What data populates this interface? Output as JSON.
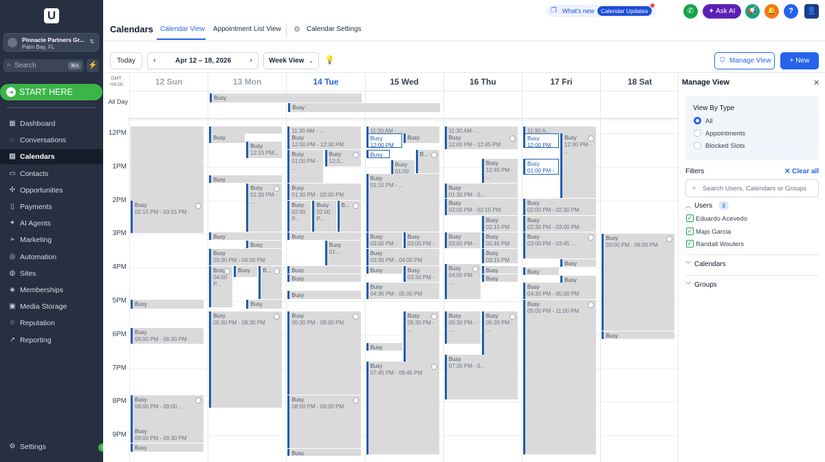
{
  "sidebar": {
    "logo": "U",
    "account": {
      "name": "Pinnacle Partners Gr...",
      "location": "Palm Bay, FL"
    },
    "search": {
      "placeholder": "Search",
      "shortcut": "⌘K"
    },
    "start_here": "START HERE",
    "nav": [
      {
        "label": "Dashboard",
        "icon": "dashboard-icon",
        "glyph": "▦"
      },
      {
        "label": "Conversations",
        "icon": "chat-icon",
        "glyph": "◌"
      },
      {
        "label": "Calendars",
        "icon": "calendar-icon",
        "glyph": "▤",
        "active": true
      },
      {
        "label": "Contacts",
        "icon": "contacts-icon",
        "glyph": "▭"
      },
      {
        "label": "Opportunities",
        "icon": "opportunities-icon",
        "glyph": "✣"
      },
      {
        "label": "Payments",
        "icon": "payments-icon",
        "glyph": "▯"
      },
      {
        "label": "AI Agents",
        "icon": "sparkle-icon",
        "glyph": "✦"
      },
      {
        "label": "Marketing",
        "icon": "send-icon",
        "glyph": "➢"
      },
      {
        "label": "Automation",
        "icon": "automation-icon",
        "glyph": "◎"
      },
      {
        "label": "Sites",
        "icon": "globe-icon",
        "glyph": "◍"
      },
      {
        "label": "Memberships",
        "icon": "memberships-icon",
        "glyph": "◈"
      },
      {
        "label": "Media Storage",
        "icon": "image-icon",
        "glyph": "▣"
      },
      {
        "label": "Reputation",
        "icon": "star-icon",
        "glyph": "☆"
      },
      {
        "label": "Reporting",
        "icon": "chart-icon",
        "glyph": "↗"
      }
    ],
    "settings": "Settings"
  },
  "header": {
    "title": "Calendars",
    "tabs": [
      "Calendar View",
      "Appointment List View",
      "Calendar Settings"
    ],
    "whats_new": "What's new",
    "updates_pill": "Calendar Updates",
    "ask_ai": "Ask AI",
    "help": "?"
  },
  "toolbar": {
    "today": "Today",
    "date_range": "Apr 12 – 18, 2026",
    "view": "Week View",
    "manage_view": "Manage View",
    "new": "New"
  },
  "calendar": {
    "gmt": "GMT\n-04:00",
    "all_day": "All Day",
    "days": [
      {
        "label": "12 Sun",
        "state": "past"
      },
      {
        "label": "13 Mon",
        "state": "past"
      },
      {
        "label": "14 Tue",
        "state": "today"
      },
      {
        "label": "15 Wed",
        "state": ""
      },
      {
        "label": "16 Thu",
        "state": ""
      },
      {
        "label": "17 Fri",
        "state": ""
      },
      {
        "label": "18 Sat",
        "state": ""
      }
    ],
    "hours": [
      "12PM",
      "1PM",
      "2PM",
      "3PM",
      "4PM",
      "5PM",
      "6PM",
      "7PM",
      "8PM",
      "9PM"
    ],
    "all_day_events": [
      {
        "day": 1,
        "span": 2,
        "row": 0,
        "title": "Busy"
      },
      {
        "day": 2,
        "span": 2,
        "row": 1,
        "title": "Busy"
      }
    ],
    "events": [
      {
        "day": 0,
        "start": 11.8,
        "end": 14.2,
        "col": 0,
        "cols": 1,
        "title": "",
        "time": "",
        "nb": true
      },
      {
        "day": 0,
        "start": 14.0,
        "end": 15.0,
        "col": 0,
        "cols": 1,
        "title": "Busy",
        "time": "02:15 PM - 03:15 PM",
        "icons": true
      },
      {
        "day": 0,
        "start": 16.95,
        "end": 17.25,
        "col": 0,
        "cols": 1,
        "title": "Busy",
        "time": ""
      },
      {
        "day": 0,
        "start": 17.8,
        "end": 18.3,
        "col": 0,
        "cols": 1,
        "title": "Busy",
        "time": "06:00 PM - 06:30 PM"
      },
      {
        "day": 0,
        "start": 19.8,
        "end": 20.8,
        "col": 0,
        "cols": 1,
        "title": "Busy",
        "time": "08:00 PM - 09:00 ...",
        "icons": true
      },
      {
        "day": 0,
        "start": 20.75,
        "end": 21.25,
        "col": 0,
        "cols": 1,
        "title": "Busy",
        "time": "09:00 PM - 09:30 PM"
      },
      {
        "day": 0,
        "start": 21.25,
        "end": 21.5,
        "col": 0,
        "cols": 1,
        "title": "Busy",
        "time": ""
      },
      {
        "day": 1,
        "start": 11.8,
        "end": 12.0,
        "col": 0,
        "cols": 1,
        "title": "",
        "time": ""
      },
      {
        "day": 1,
        "start": 12.0,
        "end": 12.3,
        "col": 0,
        "cols": 2,
        "title": "Busy",
        "time": ""
      },
      {
        "day": 1,
        "start": 12.25,
        "end": 12.75,
        "col": 1,
        "cols": 2,
        "title": "Busy",
        "time": "12:15 PM..."
      },
      {
        "day": 1,
        "start": 13.25,
        "end": 13.5,
        "col": 0,
        "cols": 1,
        "title": "Busy",
        "time": ""
      },
      {
        "day": 1,
        "start": 13.5,
        "end": 14.95,
        "col": 1,
        "cols": 2,
        "title": "Busy",
        "time": "01:30 PM - ...",
        "icons": true
      },
      {
        "day": 1,
        "start": 14.95,
        "end": 15.2,
        "col": 0,
        "cols": 1,
        "title": "Busy",
        "time": ""
      },
      {
        "day": 1,
        "start": 15.2,
        "end": 15.45,
        "col": 1,
        "cols": 2,
        "title": "Busy",
        "time": ""
      },
      {
        "day": 1,
        "start": 15.45,
        "end": 15.95,
        "col": 0,
        "cols": 1,
        "title": "Busy",
        "time": "03:30 PM - 04:00 PM"
      },
      {
        "day": 1,
        "start": 15.95,
        "end": 17.2,
        "col": 0,
        "cols": 3,
        "title": "Busy",
        "time": "04:00 P...",
        "icons": true
      },
      {
        "day": 1,
        "start": 15.95,
        "end": 16.3,
        "col": 1,
        "cols": 3,
        "title": "Busy",
        "time": ""
      },
      {
        "day": 1,
        "start": 15.95,
        "end": 16.95,
        "col": 2,
        "cols": 3,
        "title": "B...",
        "time": "",
        "icons": true
      },
      {
        "day": 1,
        "start": 16.95,
        "end": 17.25,
        "col": 1,
        "cols": 2,
        "title": "Busy",
        "time": "05:00 PM - ..."
      },
      {
        "day": 1,
        "start": 17.3,
        "end": 20.2,
        "col": 0,
        "cols": 1,
        "title": "Busy",
        "time": "05:30 PM - 08:30 PM",
        "icons": true
      },
      {
        "day": 2,
        "start": 11.8,
        "end": 12.0,
        "col": 0,
        "cols": 1,
        "title": "",
        "time": "11:30 AM - ..."
      },
      {
        "day": 2,
        "start": 12.0,
        "end": 12.5,
        "col": 0,
        "cols": 1,
        "title": "Busy",
        "time": "12:00 PM - 12:30 PM"
      },
      {
        "day": 2,
        "start": 12.5,
        "end": 13.5,
        "col": 0,
        "cols": 2,
        "title": "Busy",
        "time": "01:00 PM - ..."
      },
      {
        "day": 2,
        "start": 12.5,
        "end": 13.0,
        "col": 1,
        "cols": 2,
        "title": "Busy",
        "time": "12:3...",
        "icons": true
      },
      {
        "day": 2,
        "start": 13.5,
        "end": 14.0,
        "col": 0,
        "cols": 1,
        "title": "Busy",
        "time": "01:30 PM - 02:00 PM"
      },
      {
        "day": 2,
        "start": 14.0,
        "end": 14.95,
        "col": 0,
        "cols": 3,
        "title": "Busy",
        "time": "02:00 P..."
      },
      {
        "day": 2,
        "start": 14.0,
        "end": 14.95,
        "col": 1,
        "cols": 3,
        "title": "Busy",
        "time": "02:00 P..."
      },
      {
        "day": 2,
        "start": 14.0,
        "end": 14.95,
        "col": 2,
        "cols": 3,
        "title": "B...",
        "time": "",
        "icons": true
      },
      {
        "day": 2,
        "start": 14.95,
        "end": 15.2,
        "col": 0,
        "cols": 1,
        "title": "Busy",
        "time": ""
      },
      {
        "day": 2,
        "start": 15.2,
        "end": 15.95,
        "col": 1,
        "cols": 2,
        "title": "Busy",
        "time": "01:..."
      },
      {
        "day": 2,
        "start": 15.95,
        "end": 16.2,
        "col": 0,
        "cols": 1,
        "title": "Busy",
        "time": ""
      },
      {
        "day": 2,
        "start": 16.2,
        "end": 16.45,
        "col": 0,
        "cols": 1,
        "title": "Busy",
        "time": ""
      },
      {
        "day": 2,
        "start": 16.7,
        "end": 16.95,
        "col": 0,
        "cols": 1,
        "title": "Busy",
        "time": ""
      },
      {
        "day": 2,
        "start": 17.3,
        "end": 19.8,
        "col": 0,
        "cols": 1,
        "title": "Busy",
        "time": "05:30 PM - 08:00 PM",
        "icons": true
      },
      {
        "day": 2,
        "start": 19.8,
        "end": 21.4,
        "col": 0,
        "cols": 1,
        "title": "Busy",
        "time": "08:00 PM - 09:30 PM",
        "icons": true
      },
      {
        "day": 2,
        "start": 21.4,
        "end": 21.6,
        "col": 0,
        "cols": 1,
        "title": "Busy",
        "time": ""
      },
      {
        "day": 3,
        "start": 11.8,
        "end": 12.0,
        "col": 0,
        "cols": 1,
        "title": "",
        "time": "11:30 AM - ..."
      },
      {
        "day": 3,
        "start": 12.0,
        "end": 12.45,
        "col": 0,
        "cols": 2,
        "title": "Busy",
        "time": "12:00 PM",
        "sel": true
      },
      {
        "day": 3,
        "start": 12.0,
        "end": 12.3,
        "col": 1,
        "cols": 2,
        "title": "Busy",
        "time": ""
      },
      {
        "day": 3,
        "start": 12.5,
        "end": 12.75,
        "col": 0,
        "cols": 3,
        "title": "Busy",
        "time": "",
        "sel": true
      },
      {
        "day": 3,
        "start": 12.5,
        "end": 13.2,
        "col": 2,
        "cols": 3,
        "title": "B...",
        "time": "",
        "icons": true
      },
      {
        "day": 3,
        "start": 12.8,
        "end": 13.95,
        "col": 1,
        "cols": 3,
        "title": "Busy",
        "time": "01:00 PM - ..."
      },
      {
        "day": 3,
        "start": 13.2,
        "end": 14.95,
        "col": 0,
        "cols": 1,
        "title": "Busy",
        "time": "01:15 PM - ..."
      },
      {
        "day": 3,
        "start": 14.95,
        "end": 15.45,
        "col": 0,
        "cols": 2,
        "title": "Busy",
        "time": "03:00 PM - 0..."
      },
      {
        "day": 3,
        "start": 14.95,
        "end": 15.45,
        "col": 1,
        "cols": 2,
        "title": "Busy",
        "time": "03:00 PM - ..."
      },
      {
        "day": 3,
        "start": 15.45,
        "end": 15.95,
        "col": 0,
        "cols": 1,
        "title": "Busy",
        "time": "03:30 PM - 04:00 PM"
      },
      {
        "day": 3,
        "start": 15.95,
        "end": 16.2,
        "col": 0,
        "cols": 2,
        "title": "Busy",
        "time": ""
      },
      {
        "day": 3,
        "start": 15.95,
        "end": 16.45,
        "col": 1,
        "cols": 2,
        "title": "Busy",
        "time": "03:30 PM - ..."
      },
      {
        "day": 3,
        "start": 16.45,
        "end": 16.95,
        "col": 0,
        "cols": 1,
        "title": "Busy",
        "time": "04:30 PM - 05:00 PM"
      },
      {
        "day": 3,
        "start": 17.3,
        "end": 19.8,
        "col": 1,
        "cols": 2,
        "title": "Busy",
        "time": "05:30 PM - ...",
        "icons": true
      },
      {
        "day": 3,
        "start": 18.25,
        "end": 18.5,
        "col": 0,
        "cols": 2,
        "title": "Busy",
        "time": ""
      },
      {
        "day": 3,
        "start": 18.8,
        "end": 21.6,
        "col": 0,
        "cols": 1,
        "title": "Busy",
        "time": "07:45 PM - 09:45 PM",
        "icons": true
      },
      {
        "day": 4,
        "start": 11.8,
        "end": 12.0,
        "col": 0,
        "cols": 1,
        "title": "",
        "time": "11:30 AM - ..."
      },
      {
        "day": 4,
        "start": 12.0,
        "end": 12.5,
        "col": 0,
        "cols": 1,
        "title": "Busy",
        "time": "12:00 PM - 12:45 PM",
        "icons": true
      },
      {
        "day": 4,
        "start": 12.75,
        "end": 13.5,
        "col": 1,
        "cols": 2,
        "title": "Busy",
        "time": "12:45 PM - ..."
      },
      {
        "day": 4,
        "start": 13.5,
        "end": 13.95,
        "col": 0,
        "cols": 1,
        "title": "Busy",
        "time": "01:30 PM - 0..."
      },
      {
        "day": 4,
        "start": 13.95,
        "end": 14.45,
        "col": 0,
        "cols": 1,
        "title": "Busy",
        "time": "02:00 PM - 02:15 PM"
      },
      {
        "day": 4,
        "start": 14.45,
        "end": 14.95,
        "col": 1,
        "cols": 2,
        "title": "Busy",
        "time": "02:15 PM ..."
      },
      {
        "day": 4,
        "start": 14.95,
        "end": 15.45,
        "col": 0,
        "cols": 2,
        "title": "Busy",
        "time": "03:00 PM - ..."
      },
      {
        "day": 4,
        "start": 14.95,
        "end": 15.45,
        "col": 1,
        "cols": 2,
        "title": "Busy",
        "time": "02:45 PM ..."
      },
      {
        "day": 4,
        "start": 15.45,
        "end": 15.9,
        "col": 1,
        "cols": 2,
        "title": "Busy",
        "time": "03:15 PM ..."
      },
      {
        "day": 4,
        "start": 15.9,
        "end": 16.95,
        "col": 0,
        "cols": 2,
        "title": "Busy",
        "time": "04:00 PM ...",
        "icons": true
      },
      {
        "day": 4,
        "start": 15.95,
        "end": 16.2,
        "col": 1,
        "cols": 2,
        "title": "Busy",
        "time": ""
      },
      {
        "day": 4,
        "start": 16.2,
        "end": 16.45,
        "col": 1,
        "cols": 2,
        "title": "Busy",
        "time": ""
      },
      {
        "day": 4,
        "start": 17.3,
        "end": 18.3,
        "col": 0,
        "cols": 2,
        "title": "Busy",
        "time": "05:30 PM - ..."
      },
      {
        "day": 4,
        "start": 17.3,
        "end": 19.95,
        "col": 1,
        "cols": 2,
        "title": "Busy",
        "time": "05:30 PM - ...",
        "icons": true
      },
      {
        "day": 4,
        "start": 18.6,
        "end": 19.95,
        "col": 0,
        "cols": 1,
        "title": "Busy",
        "time": "07:30 PM - 0..."
      },
      {
        "day": 5,
        "start": 11.8,
        "end": 12.0,
        "col": 0,
        "cols": 1,
        "title": "",
        "time": "11:30 A..."
      },
      {
        "day": 5,
        "start": 12.0,
        "end": 12.45,
        "col": 0,
        "cols": 2,
        "title": "Busy",
        "time": "12:00 PM",
        "sel": true
      },
      {
        "day": 5,
        "start": 12.0,
        "end": 13.95,
        "col": 1,
        "cols": 2,
        "title": "Busy",
        "time": "12:00 PM - ...",
        "icons": true
      },
      {
        "day": 5,
        "start": 12.75,
        "end": 13.25,
        "col": 0,
        "cols": 2,
        "title": "Busy",
        "time": "01:00 PM - 0...",
        "sel": true
      },
      {
        "day": 5,
        "start": 13.95,
        "end": 14.45,
        "col": 0,
        "cols": 1,
        "title": "Busy",
        "time": "02:00 PM - 02:30 PM"
      },
      {
        "day": 5,
        "start": 14.45,
        "end": 14.95,
        "col": 0,
        "cols": 1,
        "title": "Busy",
        "time": "02:30 PM - 03:00 PM"
      },
      {
        "day": 5,
        "start": 14.95,
        "end": 15.75,
        "col": 0,
        "cols": 1,
        "title": "Busy",
        "time": "03:00 PM - 03:45 ...",
        "icons": true
      },
      {
        "day": 5,
        "start": 15.75,
        "end": 16.0,
        "col": 1,
        "cols": 2,
        "title": "Busy",
        "time": ""
      },
      {
        "day": 5,
        "start": 16.0,
        "end": 16.25,
        "col": 0,
        "cols": 2,
        "title": "Busy",
        "time": ""
      },
      {
        "day": 5,
        "start": 16.25,
        "end": 16.45,
        "col": 1,
        "cols": 2,
        "title": "Busy",
        "time": ""
      },
      {
        "day": 5,
        "start": 16.45,
        "end": 16.95,
        "col": 0,
        "cols": 1,
        "title": "Busy",
        "time": "04:30 PM - 05:00 PM"
      },
      {
        "day": 5,
        "start": 16.95,
        "end": 21.6,
        "col": 0,
        "cols": 1,
        "title": "Busy",
        "time": "05:00 PM - 11:00 PM",
        "icons": true
      },
      {
        "day": 6,
        "start": 15.0,
        "end": 17.9,
        "col": 0,
        "cols": 1,
        "title": "Busy",
        "time": "03:00 PM - 06:00 PM",
        "icons": true
      },
      {
        "day": 6,
        "start": 17.9,
        "end": 18.15,
        "col": 0,
        "cols": 1,
        "title": "Busy",
        "time": ""
      }
    ]
  },
  "panel": {
    "title": "Manage View",
    "view_by_type": "View By Type",
    "types": [
      "All",
      "Appointments",
      "Blocked Slots"
    ],
    "filters": "Filters",
    "clear_all": "Clear all",
    "search_placeholder": "Search Users, Calendars or Groups",
    "users_label": "Users",
    "users_count": "3",
    "users": [
      "Eduardo Acevedo",
      "Majo Garcia",
      "Randall Wouters"
    ],
    "calendars_label": "Calendars",
    "groups_label": "Groups"
  },
  "colors": {
    "sidebar": "#263041",
    "accent": "#2563eb",
    "start_here": "#3bb54a",
    "event": "#dadada",
    "event_bar": "#1e5bb0"
  }
}
